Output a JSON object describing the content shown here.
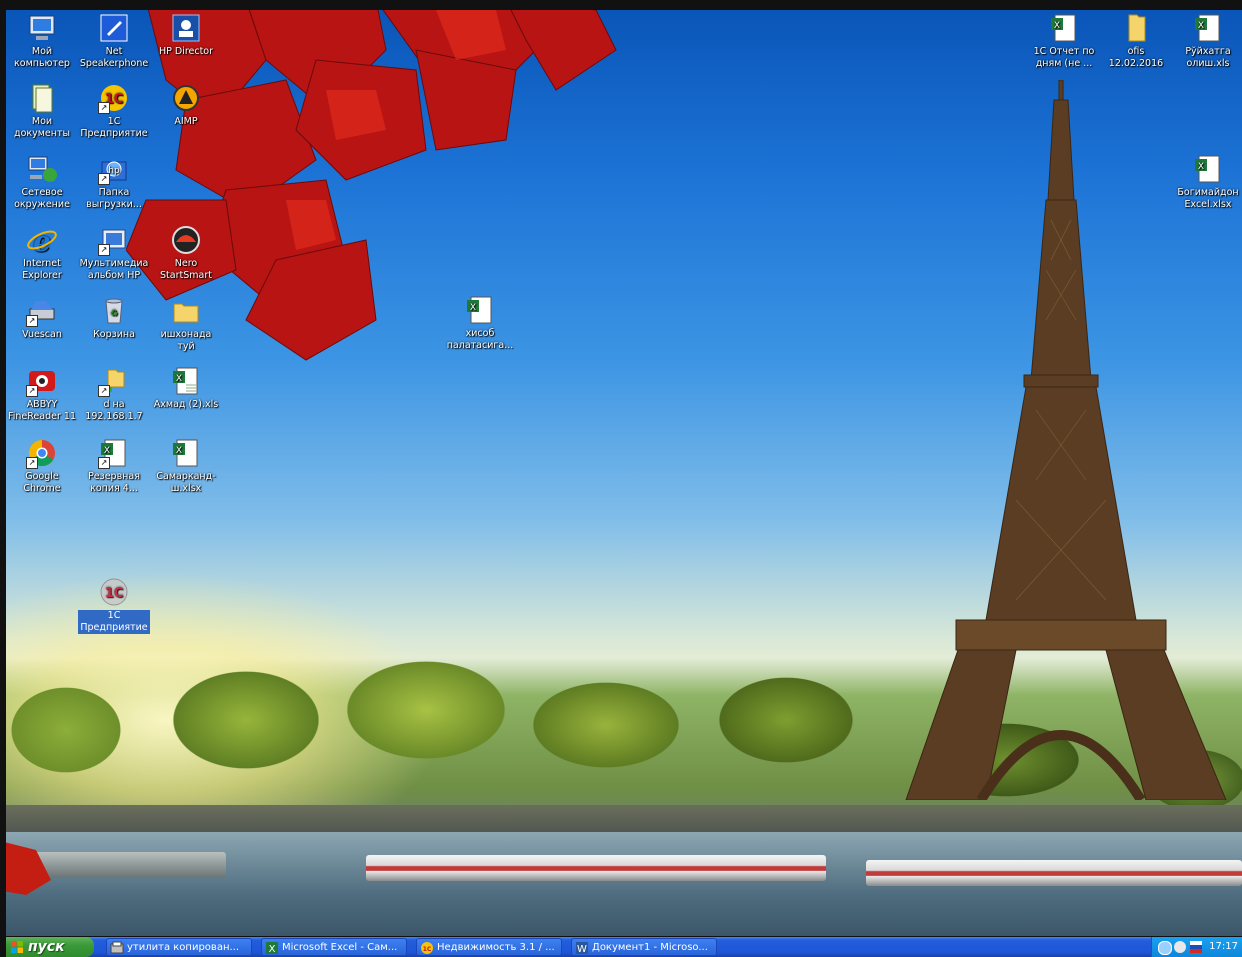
{
  "desktop": {
    "icons": [
      {
        "name": "my-computer-icon",
        "label": "Мой компьютер"
      },
      {
        "name": "net-speakerphone-icon",
        "label": "Net Speakerphone"
      },
      {
        "name": "hp-director-icon",
        "label": "HP Director"
      },
      {
        "name": "my-documents-icon",
        "label": "Мои документы"
      },
      {
        "name": "1c-enterprise-icon",
        "label": "1С Предприятие"
      },
      {
        "name": "aimp-icon",
        "label": "AIMP"
      },
      {
        "name": "network-places-icon",
        "label": "Сетевое окружение"
      },
      {
        "name": "export-folder-icon",
        "label": "Папка выгрузки..."
      },
      {
        "name": "internet-explorer-icon",
        "label": "Internet Explorer"
      },
      {
        "name": "hp-media-album-icon",
        "label": "Мультимедиа альбом HP"
      },
      {
        "name": "nero-startsmart-icon",
        "label": "Nero StartSmart"
      },
      {
        "name": "vuescan-icon",
        "label": "Vuescan"
      },
      {
        "name": "recycle-bin-icon",
        "label": "Корзина"
      },
      {
        "name": "wedding-docs-folder-icon",
        "label": "ишхонада туй"
      },
      {
        "name": "abbyy-finereader-icon",
        "label": "ABBYY FineReader 11"
      },
      {
        "name": "network-share-folder-icon",
        "label": "d на 192.168.1.7"
      },
      {
        "name": "excel-akhmad-icon",
        "label": "Ахмад (2).xls"
      },
      {
        "name": "google-chrome-icon",
        "label": "Google Chrome"
      },
      {
        "name": "excel-backup-copy-icon",
        "label": "Резервная копия 4..."
      },
      {
        "name": "excel-samarkand-icon",
        "label": "Самарканд-ш.xlsx"
      },
      {
        "name": "excel-hisob-icon",
        "label": "хисоб палатасига..."
      },
      {
        "name": "1c-enterprise-selected-icon",
        "label": "1С Предприятие"
      },
      {
        "name": "excel-1c-report-icon",
        "label": "1С Отчет по дням (не ..."
      },
      {
        "name": "ofis-folder-icon",
        "label": "ofis 12.02.2016"
      },
      {
        "name": "excel-ruyhatga-icon",
        "label": "Рўйхатга олиш.xls"
      },
      {
        "name": "excel-bogimaidon-icon",
        "label": "Богимайдон Excel.xlsx"
      }
    ]
  },
  "taskbar": {
    "start_label": "пуск",
    "tasks": [
      {
        "label": "утилита копирован..."
      },
      {
        "label": "Microsoft Excel - Сам..."
      },
      {
        "label": "Недвижимость 3.1 / ..."
      },
      {
        "label": "Документ1 - Microso..."
      }
    ],
    "clock": "17:17"
  },
  "colors": {
    "taskbar_blue": "#245edb",
    "start_green": "#3c9a3a",
    "selection_blue": "#316ac5",
    "tray_blue": "#0e86dc"
  }
}
